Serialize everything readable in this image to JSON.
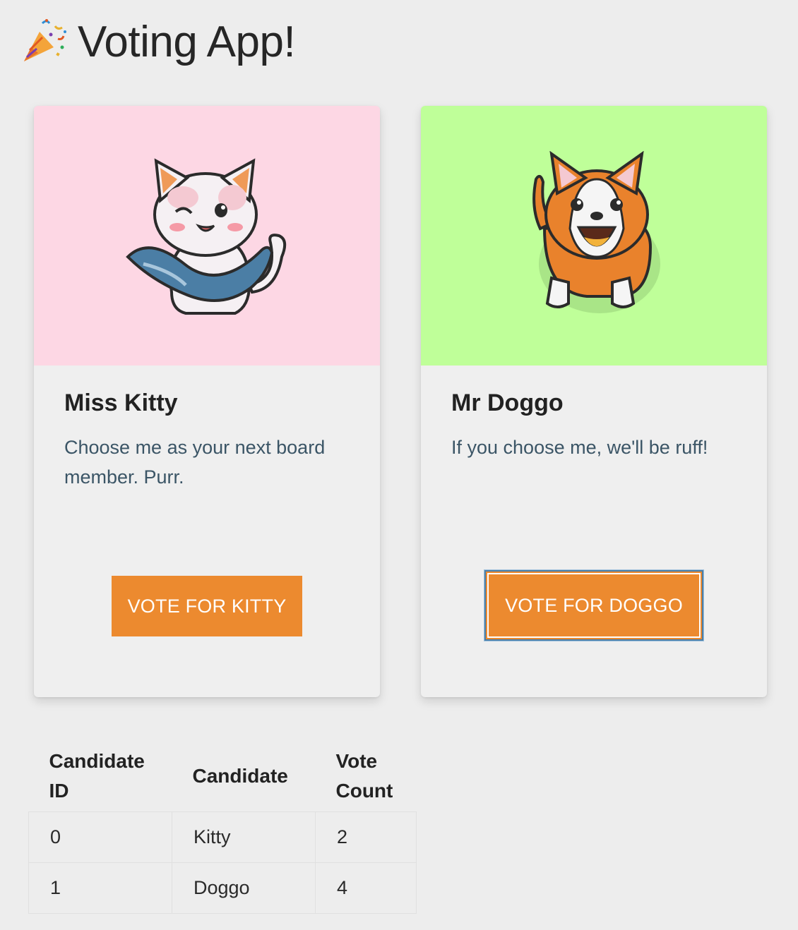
{
  "app": {
    "title": "Voting App!",
    "title_icon": "party-popper-icon"
  },
  "candidates": [
    {
      "name": "Miss Kitty",
      "description": "Choose me as your next board member. Purr.",
      "vote_button_label": "VOTE FOR KITTY",
      "image": "cat-illustration",
      "image_bg_color": "#fdd7e4"
    },
    {
      "name": "Mr Doggo",
      "description": "If you choose me, we'll be ruff!",
      "vote_button_label": "VOTE FOR DOGGO",
      "image": "corgi-illustration",
      "image_bg_color": "#bfff99"
    }
  ],
  "button_color": "#ec8a2f",
  "results_table": {
    "headers": [
      "Candidate ID",
      "Candidate",
      "Vote Count"
    ],
    "rows": [
      [
        "0",
        "Kitty",
        "2"
      ],
      [
        "1",
        "Doggo",
        "4"
      ]
    ]
  }
}
